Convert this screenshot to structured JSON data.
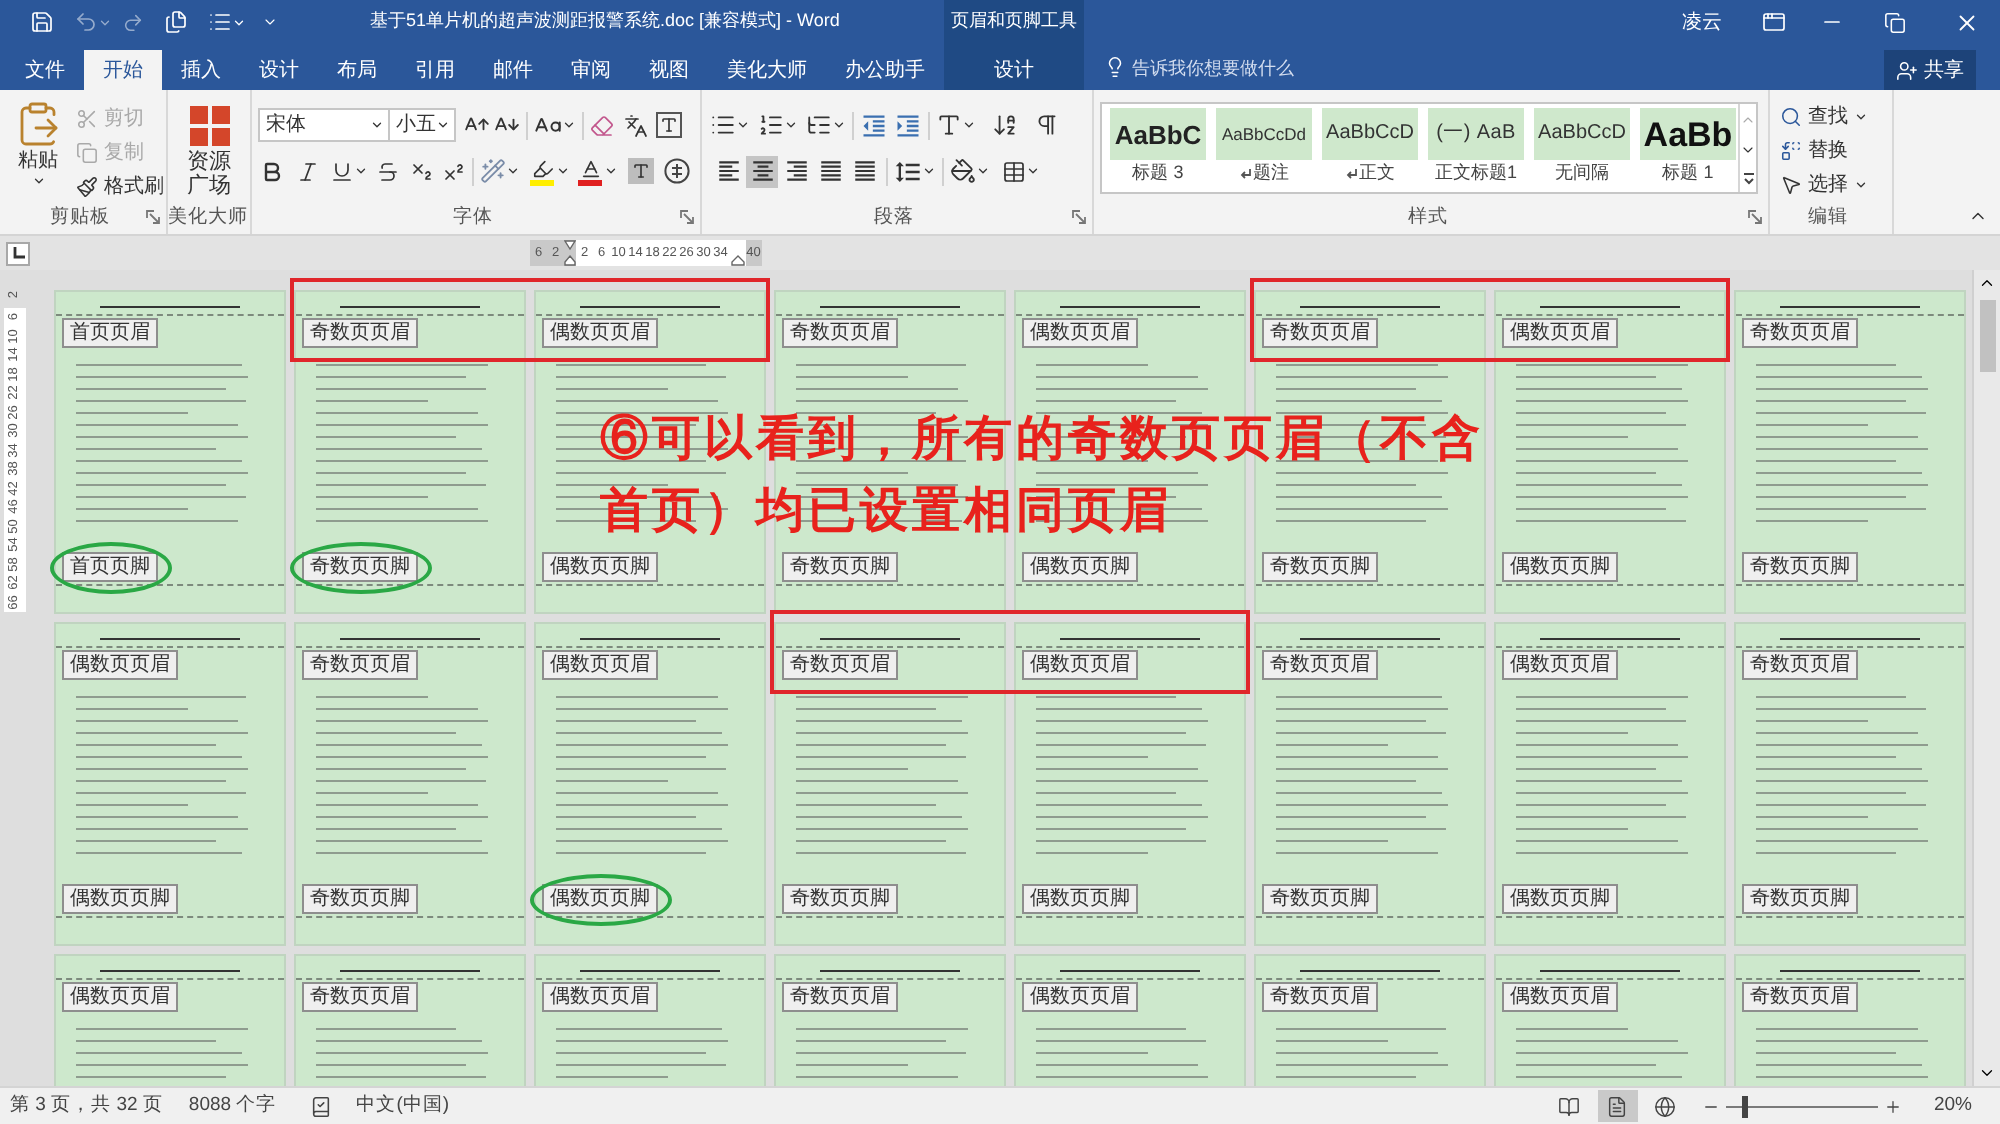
{
  "title_bar": {
    "title": "基于51单片机的超声波测距报警系统.doc [兼容模式] - Word",
    "context_group": "页眉和页脚工具",
    "user": "凌云"
  },
  "tabs": [
    {
      "label": "文件",
      "selected": false,
      "kind": "main"
    },
    {
      "label": "开始",
      "selected": true,
      "kind": "main"
    },
    {
      "label": "插入",
      "selected": false,
      "kind": "main"
    },
    {
      "label": "设计",
      "selected": false,
      "kind": "main"
    },
    {
      "label": "布局",
      "selected": false,
      "kind": "main"
    },
    {
      "label": "引用",
      "selected": false,
      "kind": "main"
    },
    {
      "label": "邮件",
      "selected": false,
      "kind": "main"
    },
    {
      "label": "审阅",
      "selected": false,
      "kind": "main"
    },
    {
      "label": "视图",
      "selected": false,
      "kind": "main"
    },
    {
      "label": "美化大师",
      "selected": false,
      "kind": "main"
    },
    {
      "label": "办公助手",
      "selected": false,
      "kind": "main"
    },
    {
      "label": "设计",
      "selected": false,
      "kind": "context"
    }
  ],
  "tell_me": {
    "placeholder": "告诉我你想要做什么"
  },
  "share": {
    "label": "共享"
  },
  "ribbon": {
    "clipboard": {
      "paste": "粘贴",
      "cut": {
        "label": "剪切",
        "disabled": true
      },
      "copy": {
        "label": "复制",
        "disabled": true
      },
      "format_painter": {
        "label": "格式刷",
        "disabled": false
      },
      "label": "剪贴板"
    },
    "beautify": {
      "button": "资源广场",
      "label": "美化大师"
    },
    "font": {
      "font_name": "宋体",
      "font_size": "小五",
      "label": "字体"
    },
    "paragraph": {
      "alignment": [
        {
          "selected": false
        },
        {
          "selected": true
        },
        {
          "selected": false
        },
        {
          "selected": false
        },
        {
          "selected": false
        }
      ],
      "label": "段落"
    },
    "styles": {
      "items": [
        {
          "preview": "AaBbC",
          "name": "标题 3",
          "kind": "heading_3",
          "paragraph_mark": false
        },
        {
          "preview": "AaBbCcDd",
          "name": "题注",
          "kind": "caption",
          "paragraph_mark": true
        },
        {
          "preview": "AaBbCcD",
          "name": "正文",
          "kind": "normal",
          "paragraph_mark": true
        },
        {
          "preview": "(一) AaB",
          "name": "正文标题1",
          "kind": "numbered",
          "paragraph_mark": false
        },
        {
          "preview": "AaBbCcD",
          "name": "无间隔",
          "kind": "normal",
          "paragraph_mark": false
        },
        {
          "preview": "AaBb",
          "name": "标题 1",
          "kind": "heading_1",
          "paragraph_mark": false
        }
      ],
      "label": "样式"
    },
    "editing": {
      "find": "查找",
      "replace": "替换",
      "select": "选择",
      "label": "编辑"
    }
  },
  "rulers": {
    "horizontal": [
      "6",
      "2",
      "2",
      "6",
      "10",
      "14",
      "18",
      "22",
      "26",
      "30",
      "34",
      "40"
    ],
    "vertical": [
      "2",
      "6",
      "10",
      "14",
      "18",
      "22",
      "26",
      "30",
      "34",
      "38",
      "42",
      "46",
      "50",
      "54",
      "58",
      "62",
      "66"
    ]
  },
  "page_rows": [
    {
      "pages": [
        {
          "header": "首页页眉",
          "footer": "首页页脚",
          "header_boxed": false,
          "footer_circled": true
        },
        {
          "header": "奇数页页眉",
          "footer": "奇数页页脚",
          "header_boxed": true,
          "footer_circled": true
        },
        {
          "header": "偶数页页眉",
          "footer": "偶数页页脚",
          "header_boxed": true,
          "footer_circled": false
        },
        {
          "header": "奇数页页眉",
          "footer": "奇数页页脚",
          "header_boxed": false,
          "footer_circled": false
        },
        {
          "header": "偶数页页眉",
          "footer": "偶数页页脚",
          "header_boxed": false,
          "footer_circled": false
        },
        {
          "header": "奇数页页眉",
          "footer": "奇数页页脚",
          "header_boxed": true,
          "footer_circled": false
        },
        {
          "header": "偶数页页眉",
          "footer": "偶数页页脚",
          "header_boxed": true,
          "footer_circled": false
        },
        {
          "header": "奇数页页眉",
          "footer": "奇数页页脚",
          "header_boxed": false,
          "footer_circled": false
        }
      ]
    },
    {
      "pages": [
        {
          "header": "偶数页页眉",
          "footer": "偶数页页脚",
          "header_boxed": false,
          "footer_circled": false
        },
        {
          "header": "奇数页页眉",
          "footer": "奇数页页脚",
          "header_boxed": false,
          "footer_circled": false
        },
        {
          "header": "偶数页页眉",
          "footer": "偶数页页脚",
          "header_boxed": false,
          "footer_circled": true
        },
        {
          "header": "奇数页页眉",
          "footer": "奇数页页脚",
          "header_boxed": true,
          "footer_circled": false
        },
        {
          "header": "偶数页页眉",
          "footer": "偶数页页脚",
          "header_boxed": true,
          "footer_circled": false
        },
        {
          "header": "奇数页页眉",
          "footer": "奇数页页脚",
          "header_boxed": false,
          "footer_circled": false
        },
        {
          "header": "偶数页页眉",
          "footer": "偶数页页脚",
          "header_boxed": false,
          "footer_circled": false
        },
        {
          "header": "奇数页页眉",
          "footer": "奇数页页脚",
          "header_boxed": false,
          "footer_circled": false
        }
      ]
    },
    {
      "pages": [
        {
          "header": "偶数页页眉",
          "header_boxed": false
        },
        {
          "header": "奇数页页眉",
          "header_boxed": false
        },
        {
          "header": "偶数页页眉",
          "header_boxed": false
        },
        {
          "header": "奇数页页眉",
          "header_boxed": false
        },
        {
          "header": "偶数页页眉",
          "header_boxed": false
        },
        {
          "header": "奇数页页眉",
          "header_boxed": false
        },
        {
          "header": "偶数页页眉",
          "header_boxed": false
        },
        {
          "header": "奇数页页眉",
          "header_boxed": false
        }
      ]
    }
  ],
  "note": {
    "lines": [
      "⑥可以看到，所有的奇数页页眉（不含",
      "首页）均已设置相同页眉"
    ]
  },
  "status_bar": {
    "page": "第 3 页，共 32 页",
    "words": "8088 个字",
    "language": "中文(中国)",
    "views": [
      {
        "selected": false
      },
      {
        "selected": true
      },
      {
        "selected": false
      }
    ],
    "zoom": {
      "level": 0.12,
      "reading": "20%"
    }
  }
}
